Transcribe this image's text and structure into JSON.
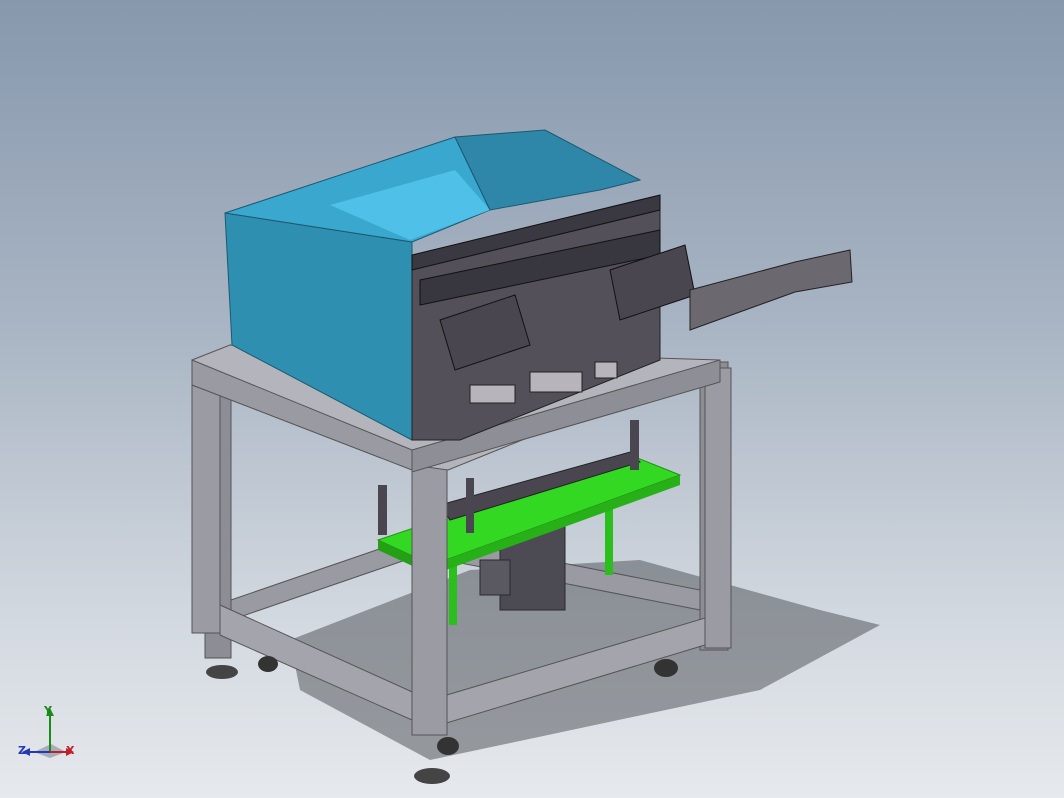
{
  "app": {
    "view": "isometric"
  },
  "triad": {
    "x_label": "X",
    "y_label": "Y",
    "z_label": "Z",
    "x_color": "#c0202a",
    "y_color": "#1a8a1a",
    "z_color": "#2438b8"
  },
  "model": {
    "colors": {
      "frame": "#8f8f97",
      "frame_dark": "#6e6e76",
      "hopper": "#2e8fb0",
      "hopper_light": "#4fbde3",
      "mechanism": "#4a4650",
      "plate": "#2fd61e",
      "plate_dark": "#23a016",
      "shadow": "#54595f"
    }
  }
}
